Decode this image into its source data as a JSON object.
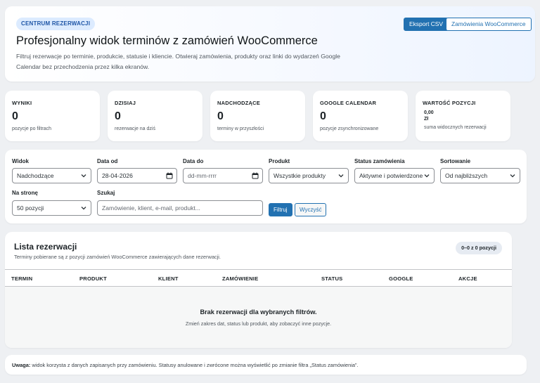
{
  "header": {
    "badge": "CENTRUM REZERWACJI",
    "title": "Profesjonalny widok terminów z zamówień WooCommerce",
    "description": "Filtruj rezerwacje po terminie, produkcie, statusie i kliencie. Otwieraj zamówienia, produkty oraz linki do wydarzeń Google Calendar bez przechodzenia przez kilka ekranów.",
    "export_button": "Eksport CSV",
    "orders_button": "Zamówienia WooCommerce"
  },
  "stats": [
    {
      "label": "WYNIKI",
      "value": "0",
      "sub": "pozycje po filtrach"
    },
    {
      "label": "DZISIAJ",
      "value": "0",
      "sub": "rezerwacje na dziś"
    },
    {
      "label": "NADCHODZĄCE",
      "value": "0",
      "sub": "terminy w przyszłości"
    },
    {
      "label": "GOOGLE CALENDAR",
      "value": "0",
      "sub": "pozycje zsynchronizowane"
    },
    {
      "label": "WARTOŚĆ POZYCJI",
      "value_amount": "0,00",
      "value_currency": "Zł",
      "sub": "suma widocznych rezerwacji"
    }
  ],
  "filters": {
    "view_label": "Widok",
    "view_value": "Nadchodzące",
    "date_from_label": "Data od",
    "date_from_value": "28-04-2026",
    "date_to_label": "Data do",
    "date_to_placeholder": "dd-mm-rrrr",
    "product_label": "Produkt",
    "product_value": "Wszystkie produkty",
    "status_label": "Status zamówienia",
    "status_value": "Aktywne i potwierdzone",
    "sort_label": "Sortowanie",
    "sort_value": "Od najbliższych",
    "per_page_label": "Na stronę",
    "per_page_value": "50 pozycji",
    "search_label": "Szukaj",
    "search_placeholder": "Zamówienie, klient, e-mail, produkt...",
    "filter_button": "Filtruj",
    "clear_button": "Wyczyść"
  },
  "list": {
    "title": "Lista rezerwacji",
    "description": "Terminy pobierane są z pozycji zamówień WooCommerce zawierających dane rezerwacji.",
    "count": "0–0 z 0 pozycji",
    "columns": [
      "TERMIN",
      "PRODUKT",
      "KLIENT",
      "ZAMÓWIENIE",
      "STATUS",
      "GOOGLE",
      "AKCJE"
    ],
    "empty_title": "Brak rezerwacji dla wybranych filtrów.",
    "empty_text": "Zmień zakres dat, status lub produkt, aby zobaczyć inne pozycje."
  },
  "note": {
    "label": "Uwaga:",
    "text": " widok korzysta z danych zapisanych przy zamówieniu. Statusy anulowane i zwrócone można wyświetlić po zmianie filtra „Status zamówienia”."
  },
  "colors": {
    "accent": "#2271b1",
    "badge_bg": "#dcebff",
    "page_bg": "#eef0f3"
  },
  "icons": {
    "select": "chevron-down-icon",
    "date": "calendar-icon"
  }
}
